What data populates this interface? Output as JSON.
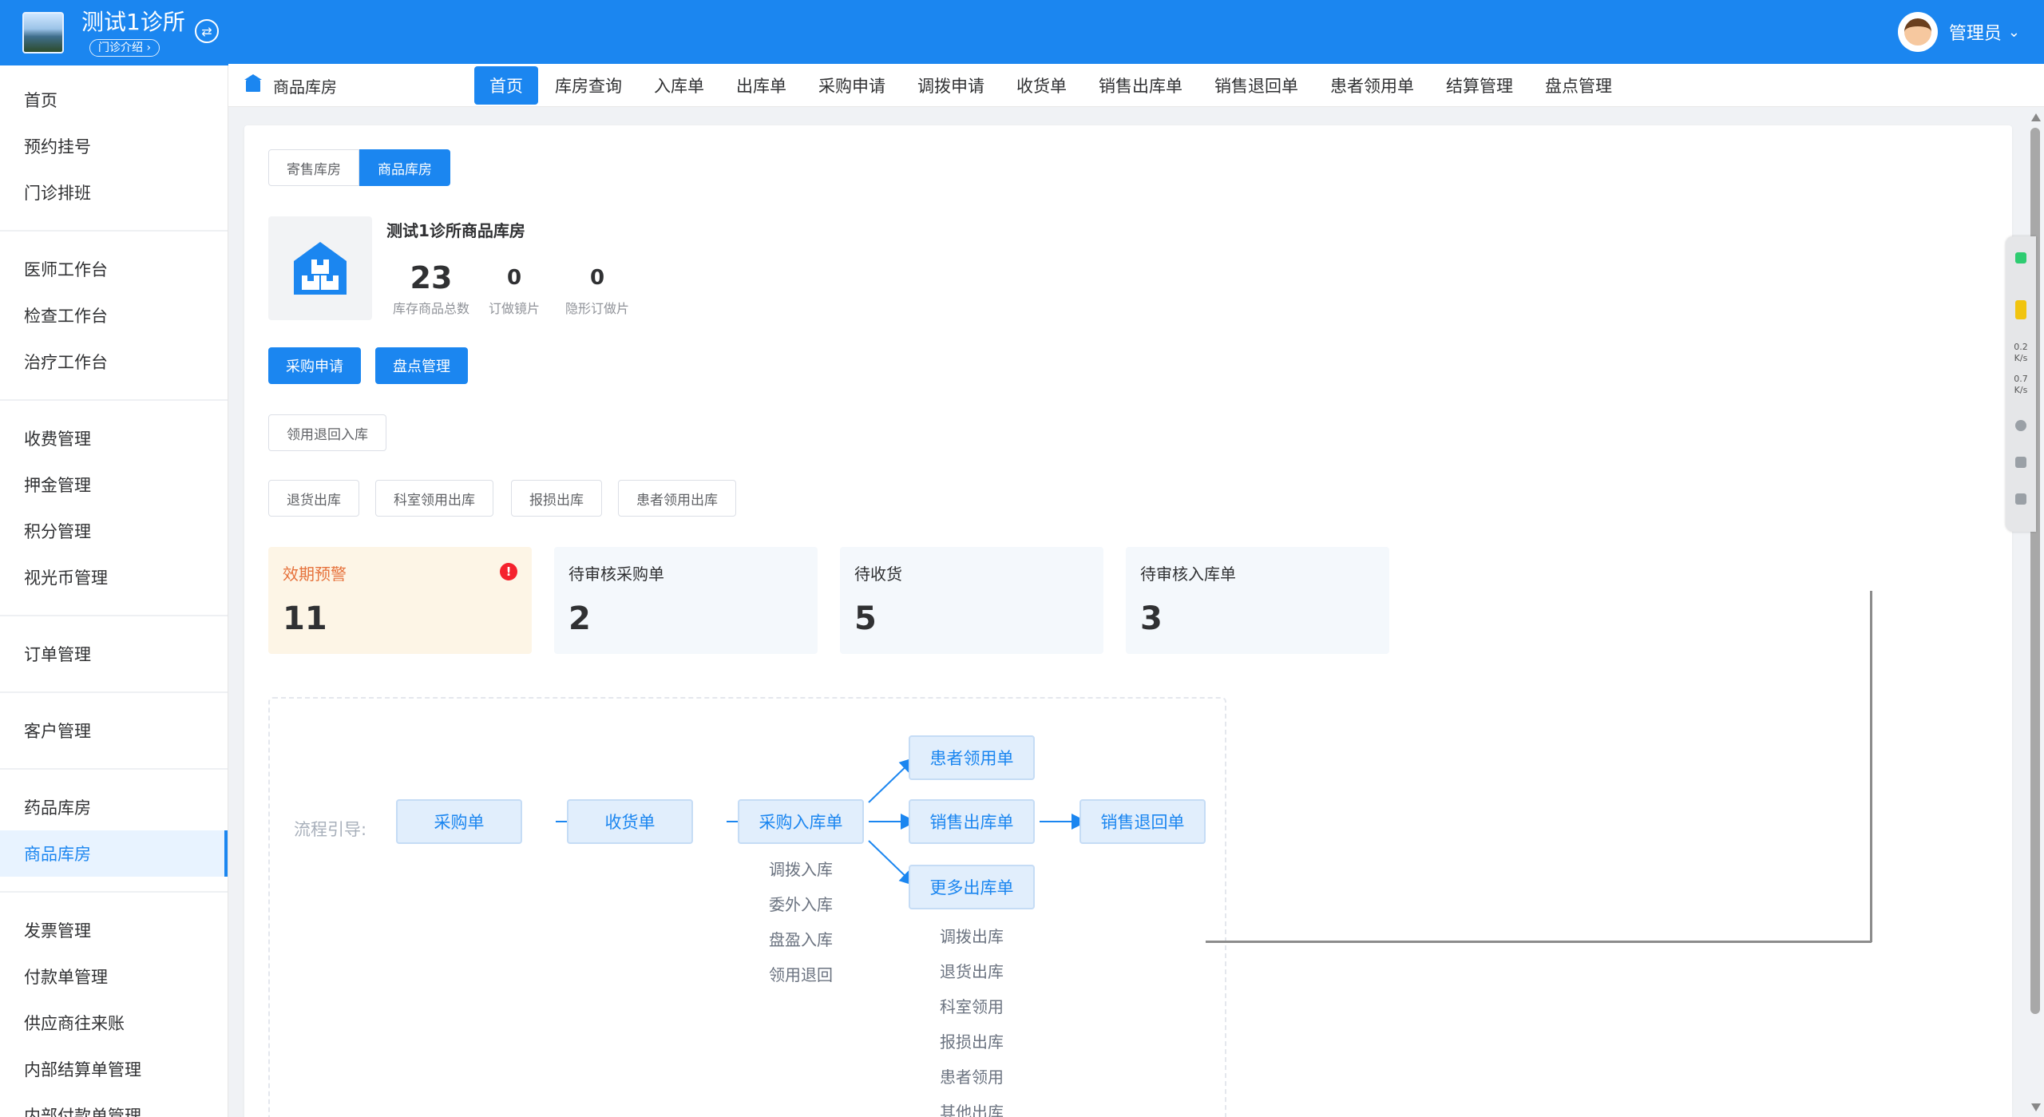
{
  "brand": {
    "title": "测试1诊所",
    "intro": "门诊介绍 ›"
  },
  "user": {
    "name": "管理员"
  },
  "sidebar": {
    "groups": [
      [
        "首页",
        "预约挂号",
        "门诊排班"
      ],
      [
        "医师工作台",
        "检查工作台",
        "治疗工作台"
      ],
      [
        "收费管理",
        "押金管理",
        "积分管理",
        "视光币管理"
      ],
      [
        "订单管理"
      ],
      [
        "客户管理"
      ],
      [
        "药品库房",
        "商品库房"
      ],
      [
        "发票管理",
        "付款单管理",
        "供应商往来账",
        "内部结算单管理",
        "内部付款单管理"
      ]
    ],
    "active": "商品库房"
  },
  "breadcrumb": "商品库房",
  "tabs": [
    "首页",
    "库房查询",
    "入库单",
    "出库单",
    "采购申请",
    "调拨申请",
    "收货单",
    "销售出库单",
    "销售退回单",
    "患者领用单",
    "结算管理",
    "盘点管理"
  ],
  "active_tab": "首页",
  "segment": {
    "left": "寄售库房",
    "right": "商品库房"
  },
  "warehouse": {
    "name": "测试1诊所商品库房",
    "stats": [
      {
        "value": "23",
        "label": "库存商品总数"
      },
      {
        "value": "0",
        "label": "订做镜片"
      },
      {
        "value": "0",
        "label": "隐形订做片"
      }
    ]
  },
  "actions": {
    "primary": [
      "采购申请",
      "盘点管理"
    ],
    "row1": [
      "领用退回入库"
    ],
    "row2": [
      "退货出库",
      "科室领用出库",
      "报损出库",
      "患者领用出库"
    ]
  },
  "kpis": [
    {
      "title": "效期预警",
      "value": "11",
      "alert": "!"
    },
    {
      "title": "待审核采购单",
      "value": "2"
    },
    {
      "title": "待收货",
      "value": "5"
    },
    {
      "title": "待审核入库单",
      "value": "3"
    }
  ],
  "flow": {
    "label": "流程引导:",
    "nodes": {
      "purchase": "采购单",
      "receive": "收货单",
      "purchase_in": "采购入库单",
      "patient_use": "患者领用单",
      "sales_out": "销售出库单",
      "sales_return": "销售退回单",
      "more_out": "更多出库单"
    },
    "in_subs": [
      "调拨入库",
      "委外入库",
      "盘盈入库",
      "领用退回"
    ],
    "out_subs": [
      "调拨出库",
      "退货出库",
      "科室领用",
      "报损出库",
      "患者领用",
      "其他出库"
    ]
  },
  "float_panel": {
    "rate1": "0.2",
    "unit1": "K/s",
    "rate2": "0.7",
    "unit2": "K/s"
  },
  "colors": {
    "primary": "#1b86f0",
    "warn_bg": "#fdf5e6",
    "warn_text": "#e6723c",
    "alert": "#f5222d"
  }
}
